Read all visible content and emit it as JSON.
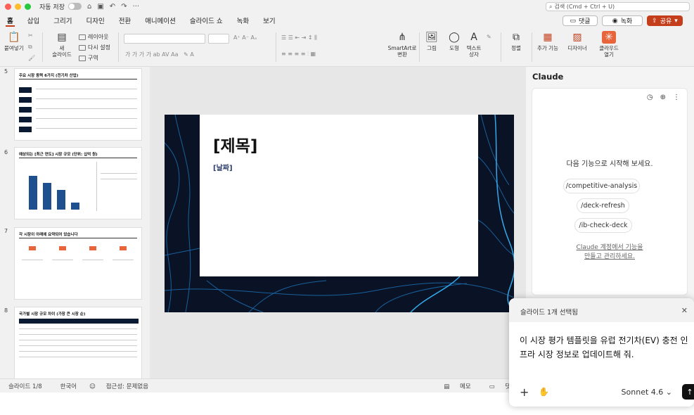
{
  "titlebar": {
    "autosave": "자동 저장",
    "search_placeholder": "검색 (Cmd + Ctrl + U)"
  },
  "tabs": [
    "홈",
    "삽입",
    "그리기",
    "디자인",
    "전환",
    "애니메이션",
    "슬라이드 쇼",
    "녹화",
    "보기"
  ],
  "active_tab": 0,
  "tab_buttons": {
    "comment": "댓글",
    "record": "녹화",
    "share": "공유"
  },
  "ribbon": {
    "paste": "붙여넣기",
    "new_slide": "새\n슬라이드",
    "layout": "레이아웃",
    "reset": "다시 설정",
    "section": "구역",
    "smartart": "SmartArt로\n변환",
    "picture": "그림",
    "shape": "도형",
    "textbox": "텍스트\n상자",
    "arrange": "정렬",
    "addins": "추가 기능",
    "designer": "디자이너",
    "claude": "클라우드\n열기"
  },
  "thumbnails": [
    {
      "num": "5",
      "title": "주요 시장 동력 6가지 (전기차 산업)"
    },
    {
      "num": "6",
      "title": "예상되는 [최근 연도] 시장 규모 (단위: 십억 원)"
    },
    {
      "num": "7",
      "title": "각 시장이 아래에 요약되어 있습니다"
    },
    {
      "num": "8",
      "title": "국가별 시장 규모 차이 (가장 큰 시장 순)"
    }
  ],
  "slide": {
    "title": "[제목]",
    "date": "[날짜]"
  },
  "claude_panel": {
    "header": "Claude",
    "start_text": "다음 기능으로 시작해 보세요.",
    "commands": [
      "/competitive-analysis",
      "/deck-refresh",
      "/ib-check-deck"
    ],
    "manage_link": "Claude 계정에서 기능을\n만들고 관리하세요."
  },
  "popup": {
    "header": "슬라이드 1개 선택됨",
    "message": "이 시장 평가 템플릿을 유럽 전기차(EV) 충전 인프라 시장 정보로 업데이트해 줘.",
    "model": "Sonnet 4.6"
  },
  "status": {
    "slide": "슬라이드 1/8",
    "lang": "한국어",
    "accessibility": "접근성: 문제없음",
    "notes": "메모",
    "comments": "댓글"
  },
  "colors": {
    "accent": "#c43e1c",
    "slide_bg": "#0a1226"
  }
}
